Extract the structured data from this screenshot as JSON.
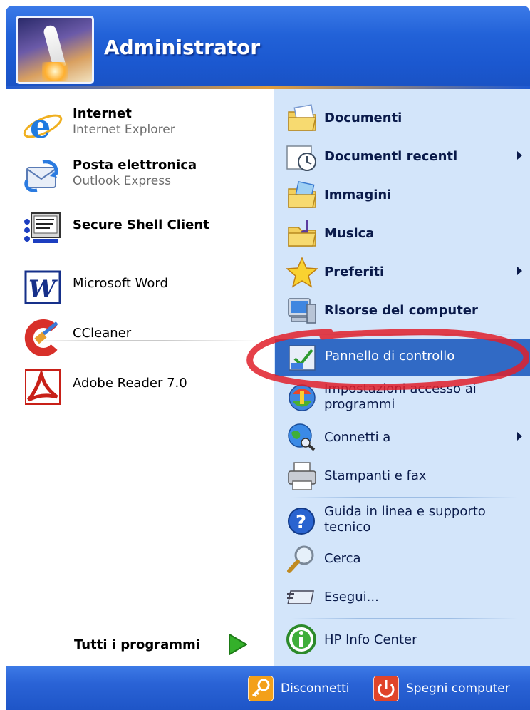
{
  "header": {
    "user_name": "Administrator"
  },
  "pinned": [
    {
      "title": "Internet",
      "subtitle": "Internet Explorer",
      "icon": "internet-explorer-icon"
    },
    {
      "title": "Posta elettronica",
      "subtitle": "Outlook Express",
      "icon": "outlook-express-icon"
    },
    {
      "title": "Secure Shell Client",
      "subtitle": "",
      "icon": "secure-shell-icon"
    }
  ],
  "recent_programs": [
    {
      "title": "Microsoft Word",
      "icon": "word-icon"
    },
    {
      "title": "CCleaner",
      "icon": "ccleaner-icon"
    },
    {
      "title": "Adobe Reader 7.0",
      "icon": "adobe-reader-icon"
    }
  ],
  "all_programs_label": "Tutti i programmi",
  "places": [
    {
      "label": "Documenti",
      "icon": "documents-folder-icon",
      "submenu": false
    },
    {
      "label": "Documenti recenti",
      "icon": "recent-documents-icon",
      "submenu": true
    },
    {
      "label": "Immagini",
      "icon": "pictures-folder-icon",
      "submenu": false
    },
    {
      "label": "Musica",
      "icon": "music-folder-icon",
      "submenu": false
    },
    {
      "label": "Preferiti",
      "icon": "favorites-star-icon",
      "submenu": true
    },
    {
      "label": "Risorse del computer",
      "icon": "my-computer-icon",
      "submenu": false
    }
  ],
  "system": [
    {
      "label": "Pannello di controllo",
      "icon": "control-panel-icon",
      "highlighted": true
    },
    {
      "label": "Impostazioni accesso ai programmi",
      "label_line1": "Impostazioni accesso ai",
      "label_line2": "programmi",
      "icon": "program-access-icon"
    },
    {
      "label": "Connetti a",
      "icon": "connect-to-icon",
      "submenu": true
    },
    {
      "label": "Stampanti e fax",
      "icon": "printers-icon"
    }
  ],
  "help": [
    {
      "label_line1": "Guida in linea e supporto",
      "label_line2": "tecnico",
      "icon": "help-icon"
    },
    {
      "label": "Cerca",
      "icon": "search-icon"
    },
    {
      "label": "Esegui...",
      "icon": "run-icon"
    }
  ],
  "extra": {
    "label": "HP Info Center",
    "icon": "hp-info-icon"
  },
  "footer": {
    "logoff_label": "Disconnetti",
    "shutdown_label": "Spegni computer"
  },
  "colors": {
    "accent_blue": "#245edb",
    "highlight": "#316ac5",
    "right_pane": "#d3e5fa",
    "annotation_red": "#e0202a"
  }
}
